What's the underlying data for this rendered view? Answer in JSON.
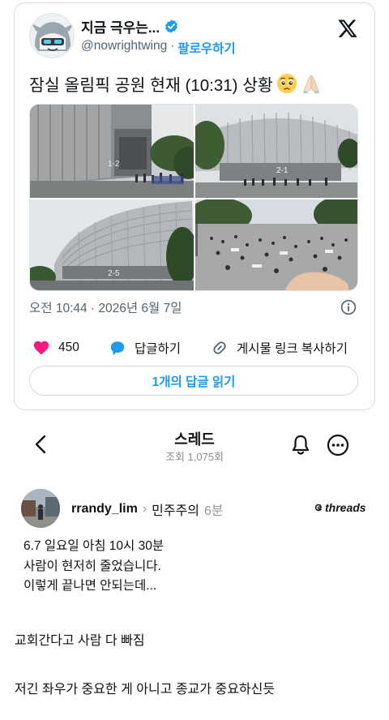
{
  "tweet": {
    "author_name": "지금 극우는...",
    "handle": "@nowrightwing",
    "separator": "·",
    "follow_label": "팔로우하기",
    "text": "잠실 올림픽 공원 현재 (10:31) 상황",
    "emojis": [
      "pleading-face-icon",
      "folded-hands-icon"
    ],
    "media": [
      {
        "label": "1-2",
        "name": "photo-stadium-entrance"
      },
      {
        "label": "2-1",
        "name": "photo-stadium-facade"
      },
      {
        "label": "2-5",
        "name": "photo-stadium-dome"
      },
      {
        "label": "",
        "name": "photo-plaza-crowd"
      }
    ],
    "timestamp": "오전 10:44 · 2026년 6월 7일",
    "like_count": "450",
    "reply_label": "답글하기",
    "copy_link_label": "게시물 링크 복사하기",
    "read_replies_label": "1개의 답글 읽기"
  },
  "threads_header": {
    "title": "스레드",
    "views": "조회 1,075회"
  },
  "post": {
    "username": "rrandy_lim",
    "chevron": "›",
    "community": "민주주의",
    "age": "6분",
    "brand": "threads",
    "lines": [
      "6.7 일요일 아침 10시 30분",
      "사람이 현저히 줄었습니다.",
      "이렇게 끝나면 안되는데..."
    ]
  },
  "comments": [
    "교회간다고 사람 다 빠짐",
    "저긴 좌우가 중요한 게 아니고 종교가 중요하신듯"
  ],
  "colors": {
    "accent": "#1d9bf0",
    "like": "#f91880",
    "text": "#0f1419",
    "muted": "#536471"
  }
}
